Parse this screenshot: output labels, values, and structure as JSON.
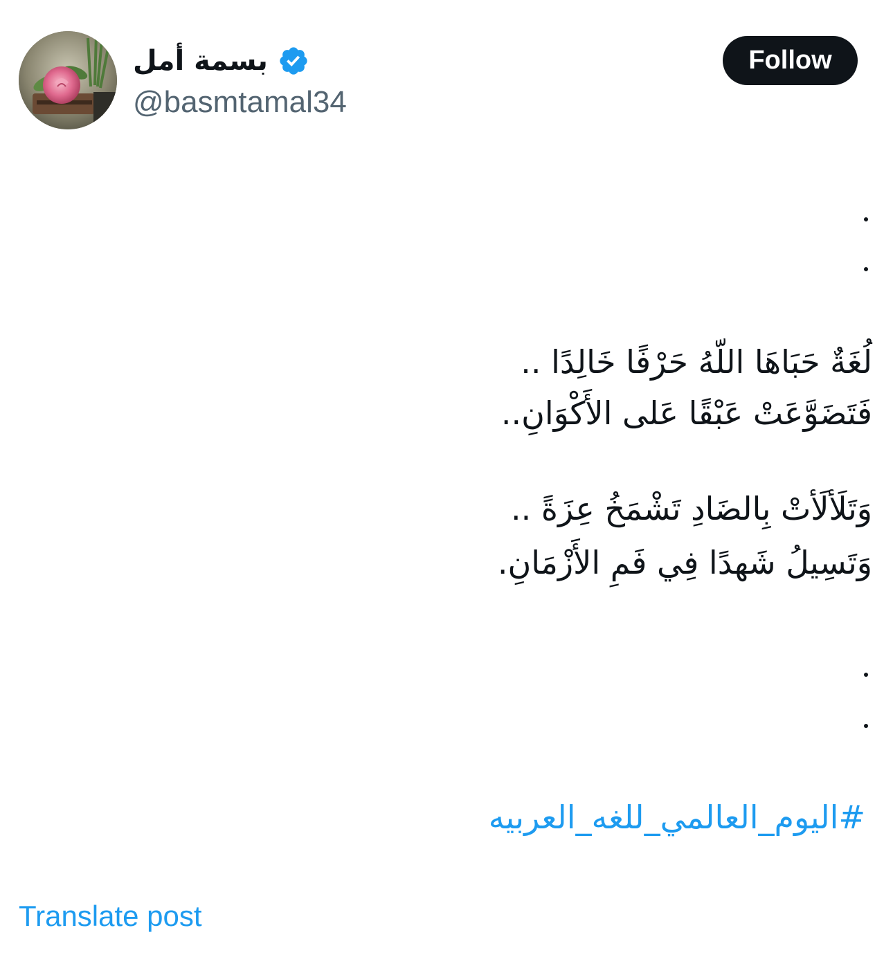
{
  "author": {
    "display_name": "بسمة أمل",
    "handle": "@basmtamal34",
    "avatar_icon": "rose-avatar-icon",
    "verified_icon": "verified-badge-icon",
    "verified_color": "#1d9bf0"
  },
  "follow_button": {
    "label": "Follow"
  },
  "post": {
    "dots": [
      ".",
      ".",
      ".",
      "."
    ],
    "lines": [
      "لُغَةٌ حَبَاهَا اللّهُ حَرْفًا خَالِدًا ..",
      "فَتَضَوَّعَتْ عَبْقًا عَلى الأَكْوَانِ..",
      "وَتَلَألَأتْ بِالضَادِ تَشْمَخُ عِزَةً ..",
      "وَتَسِيلُ شَهدًا فِي فَمِ الأَزْمَانِ."
    ],
    "hashtag": "#اليوم_العالمي_للغه_العربيه"
  },
  "translate_label": "Translate post",
  "colors": {
    "text": "#0f1419",
    "secondary": "#536471",
    "link": "#1d9bf0",
    "button_bg": "#0f1419",
    "button_text": "#ffffff"
  }
}
